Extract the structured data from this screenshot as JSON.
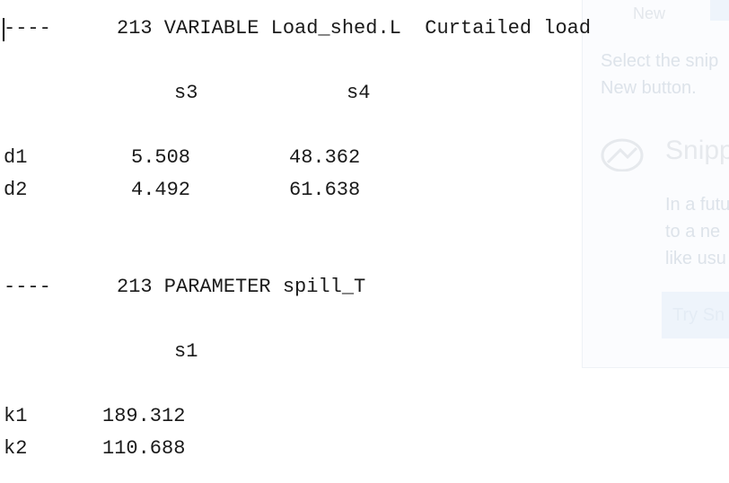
{
  "output": {
    "block1": {
      "header_dashes": "----",
      "header_text": "213 VARIABLE Load_shed.L  Curtailed load",
      "col_headers": [
        "s3",
        "s4"
      ],
      "rows": [
        {
          "label": "d1",
          "values": [
            "5.508",
            "48.362"
          ]
        },
        {
          "label": "d2",
          "values": [
            "4.492",
            "61.638"
          ]
        }
      ]
    },
    "block2": {
      "header_dashes": "----",
      "header_text": "213 PARAMETER spill_T",
      "col_headers": [
        "s1"
      ],
      "rows": [
        {
          "label": "k1",
          "values": [
            "189.312"
          ]
        },
        {
          "label": "k2",
          "values": [
            "110.688"
          ]
        }
      ]
    }
  },
  "snip_panel": {
    "new_label": "New",
    "hint_line1": "Select the snip",
    "hint_line2": "New button.",
    "app_title": "Snipp",
    "future_line1": "In a futu",
    "future_line2": "to a ne",
    "future_line3": "like usu",
    "try_label": "Try Sn"
  }
}
